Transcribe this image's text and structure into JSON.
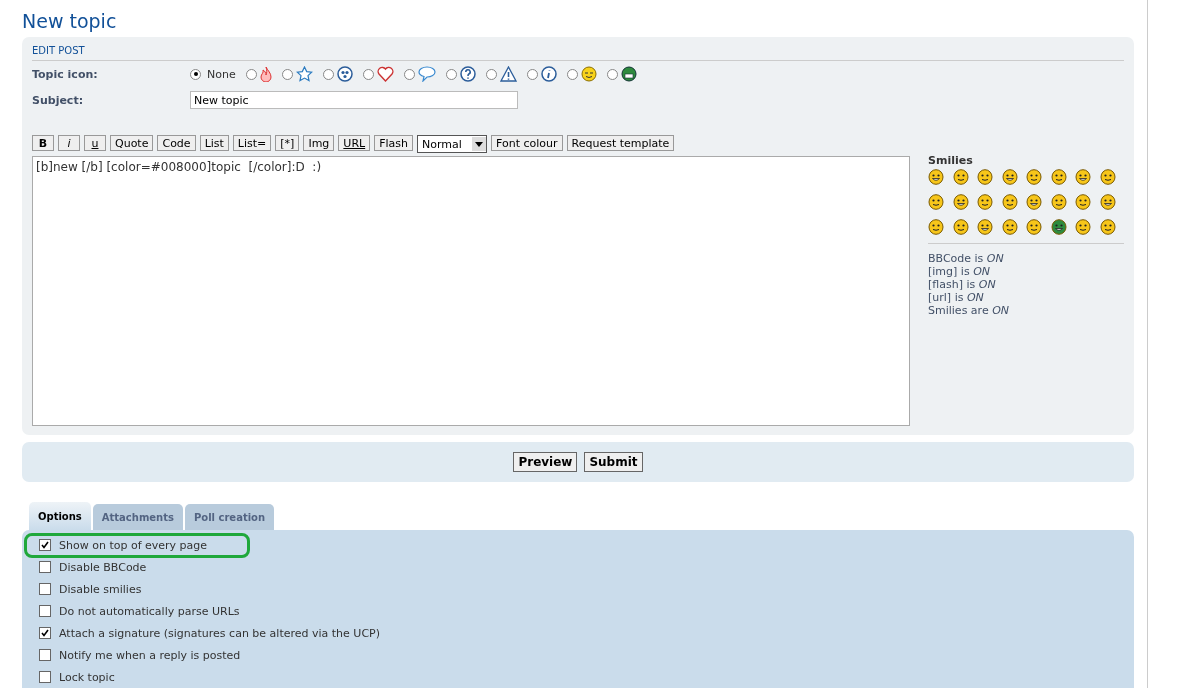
{
  "page_title": "New topic",
  "edit_post": {
    "heading": "EDIT POST",
    "topic_icon": {
      "label": "Topic icon:",
      "options": [
        {
          "label": "None",
          "selected": true
        },
        {
          "selected": false
        },
        {
          "selected": false
        },
        {
          "selected": false
        },
        {
          "selected": false
        },
        {
          "selected": false
        },
        {
          "selected": false
        },
        {
          "selected": false
        },
        {
          "selected": false
        },
        {
          "selected": false
        },
        {
          "selected": false
        }
      ]
    },
    "subject": {
      "label": "Subject:",
      "value": "New topic"
    },
    "toolbar": [
      {
        "label": "B",
        "kind": "bold"
      },
      {
        "label": "i",
        "kind": "italic"
      },
      {
        "label": "u",
        "kind": "underline"
      },
      {
        "label": "Quote",
        "kind": "plain"
      },
      {
        "label": "Code",
        "kind": "plain"
      },
      {
        "label": "List",
        "kind": "plain"
      },
      {
        "label": "List=",
        "kind": "plain"
      },
      {
        "label": "[*]",
        "kind": "plain"
      },
      {
        "label": "Img",
        "kind": "plain"
      },
      {
        "label": "URL",
        "kind": "underline"
      },
      {
        "label": "Flash",
        "kind": "plain"
      },
      {
        "label": "Normal",
        "kind": "select"
      },
      {
        "label": "Font colour",
        "kind": "plain"
      },
      {
        "label": "Request template",
        "kind": "plain"
      }
    ],
    "message": "[b]new [/b] [color=#008000]topic  [/color]:D  :)",
    "smilies": {
      "heading": "Smilies"
    },
    "status": [
      "BBCode is *ON*",
      "[img] is *ON*",
      "[flash] is *ON*",
      "[url] is *ON*",
      "Smilies are *ON*"
    ]
  },
  "actions": [
    "Preview",
    "Submit"
  ],
  "tabs": [
    {
      "label": "Options",
      "selected": true
    },
    {
      "label": "Attachments",
      "selected": false
    },
    {
      "label": "Poll creation",
      "selected": false
    }
  ],
  "options": [
    {
      "label": "Show on top of every page",
      "checked": true,
      "highlighted": true
    },
    {
      "label": "Disable BBCode",
      "checked": false,
      "highlighted": false
    },
    {
      "label": "Disable smilies",
      "checked": false,
      "highlighted": false
    },
    {
      "label": "Do not automatically parse URLs",
      "checked": false,
      "highlighted": false
    },
    {
      "label": "Attach a signature (signatures can be altered via the UCP)",
      "checked": true,
      "highlighted": false
    },
    {
      "label": "Notify me when a reply is posted",
      "checked": false,
      "highlighted": false
    },
    {
      "label": "Lock topic",
      "checked": false,
      "highlighted": false
    }
  ]
}
